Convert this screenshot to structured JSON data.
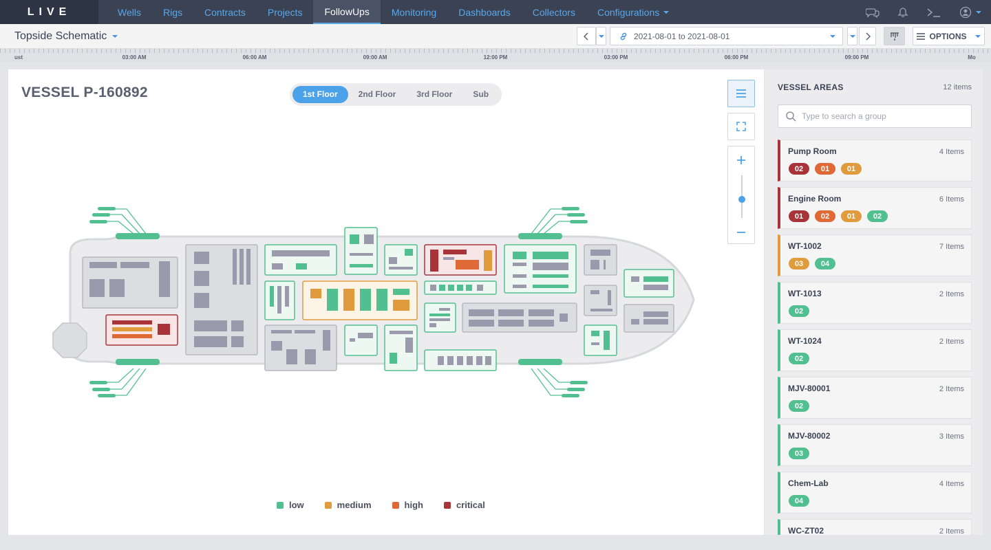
{
  "app": {
    "logo": "LIVE"
  },
  "nav": {
    "items": [
      {
        "label": "Wells",
        "active": false
      },
      {
        "label": "Rigs",
        "active": false
      },
      {
        "label": "Contracts",
        "active": false
      },
      {
        "label": "Projects",
        "active": false
      },
      {
        "label": "FollowUps",
        "active": true
      },
      {
        "label": "Monitoring",
        "active": false
      },
      {
        "label": "Dashboards",
        "active": false
      },
      {
        "label": "Collectors",
        "active": false
      },
      {
        "label": "Configurations",
        "active": false
      }
    ],
    "icons": [
      "chat-icon",
      "bell-icon",
      "terminal-icon",
      "user-icon"
    ]
  },
  "toolbar": {
    "page_title": "Topside Schematic",
    "date_range": "2021-08-01 to 2021-08-01",
    "options_label": "OPTIONS"
  },
  "timeline": {
    "labels": [
      "ust",
      "03:00 AM",
      "06:00 AM",
      "09:00 AM",
      "12:00 PM",
      "03:00 PM",
      "06:00 PM",
      "09:00 PM",
      "Mo"
    ]
  },
  "main": {
    "vessel_title": "VESSEL P-160892",
    "floors": [
      {
        "label": "1st Floor",
        "active": true
      },
      {
        "label": "2nd Floor",
        "active": false
      },
      {
        "label": "3rd Floor",
        "active": false
      },
      {
        "label": "Sub",
        "active": false
      }
    ],
    "zoom_level": 0.42,
    "legend": [
      {
        "label": "low",
        "color": "#52bf90"
      },
      {
        "label": "medium",
        "color": "#e09b3d"
      },
      {
        "label": "high",
        "color": "#e06a35"
      },
      {
        "label": "critical",
        "color": "#a8343a"
      }
    ]
  },
  "side": {
    "title": "VESSEL AREAS",
    "count": "12 items",
    "search_placeholder": "Type to search a group",
    "areas": [
      {
        "name": "Pump Room",
        "count": "4 Items",
        "severity": "critical",
        "badges": [
          {
            "value": "02",
            "level": "critical"
          },
          {
            "value": "01",
            "level": "high"
          },
          {
            "value": "01",
            "level": "medium"
          }
        ]
      },
      {
        "name": "Engine Room",
        "count": "6 Items",
        "severity": "critical",
        "badges": [
          {
            "value": "01",
            "level": "critical"
          },
          {
            "value": "02",
            "level": "high"
          },
          {
            "value": "01",
            "level": "medium"
          },
          {
            "value": "02",
            "level": "low"
          }
        ]
      },
      {
        "name": "WT-1002",
        "count": "7 Items",
        "severity": "medium",
        "badges": [
          {
            "value": "03",
            "level": "medium"
          },
          {
            "value": "04",
            "level": "low"
          }
        ]
      },
      {
        "name": "WT-1013",
        "count": "2 Items",
        "severity": "low",
        "badges": [
          {
            "value": "02",
            "level": "low"
          }
        ]
      },
      {
        "name": "WT-1024",
        "count": "2 Items",
        "severity": "low",
        "badges": [
          {
            "value": "02",
            "level": "low"
          }
        ]
      },
      {
        "name": "MJV-80001",
        "count": "2 Items",
        "severity": "low",
        "badges": [
          {
            "value": "02",
            "level": "low"
          }
        ]
      },
      {
        "name": "MJV-80002",
        "count": "3 Items",
        "severity": "low",
        "badges": [
          {
            "value": "03",
            "level": "low"
          }
        ]
      },
      {
        "name": "Chem-Lab",
        "count": "4 Items",
        "severity": "low",
        "badges": [
          {
            "value": "04",
            "level": "low"
          }
        ]
      },
      {
        "name": "WC-ZT02",
        "count": "2 Items",
        "severity": "low",
        "badges": []
      }
    ]
  },
  "colors": {
    "low": "#52bf90",
    "medium": "#e09b3d",
    "high": "#e06a35",
    "critical": "#a8343a",
    "accent": "#4ca2e8"
  }
}
